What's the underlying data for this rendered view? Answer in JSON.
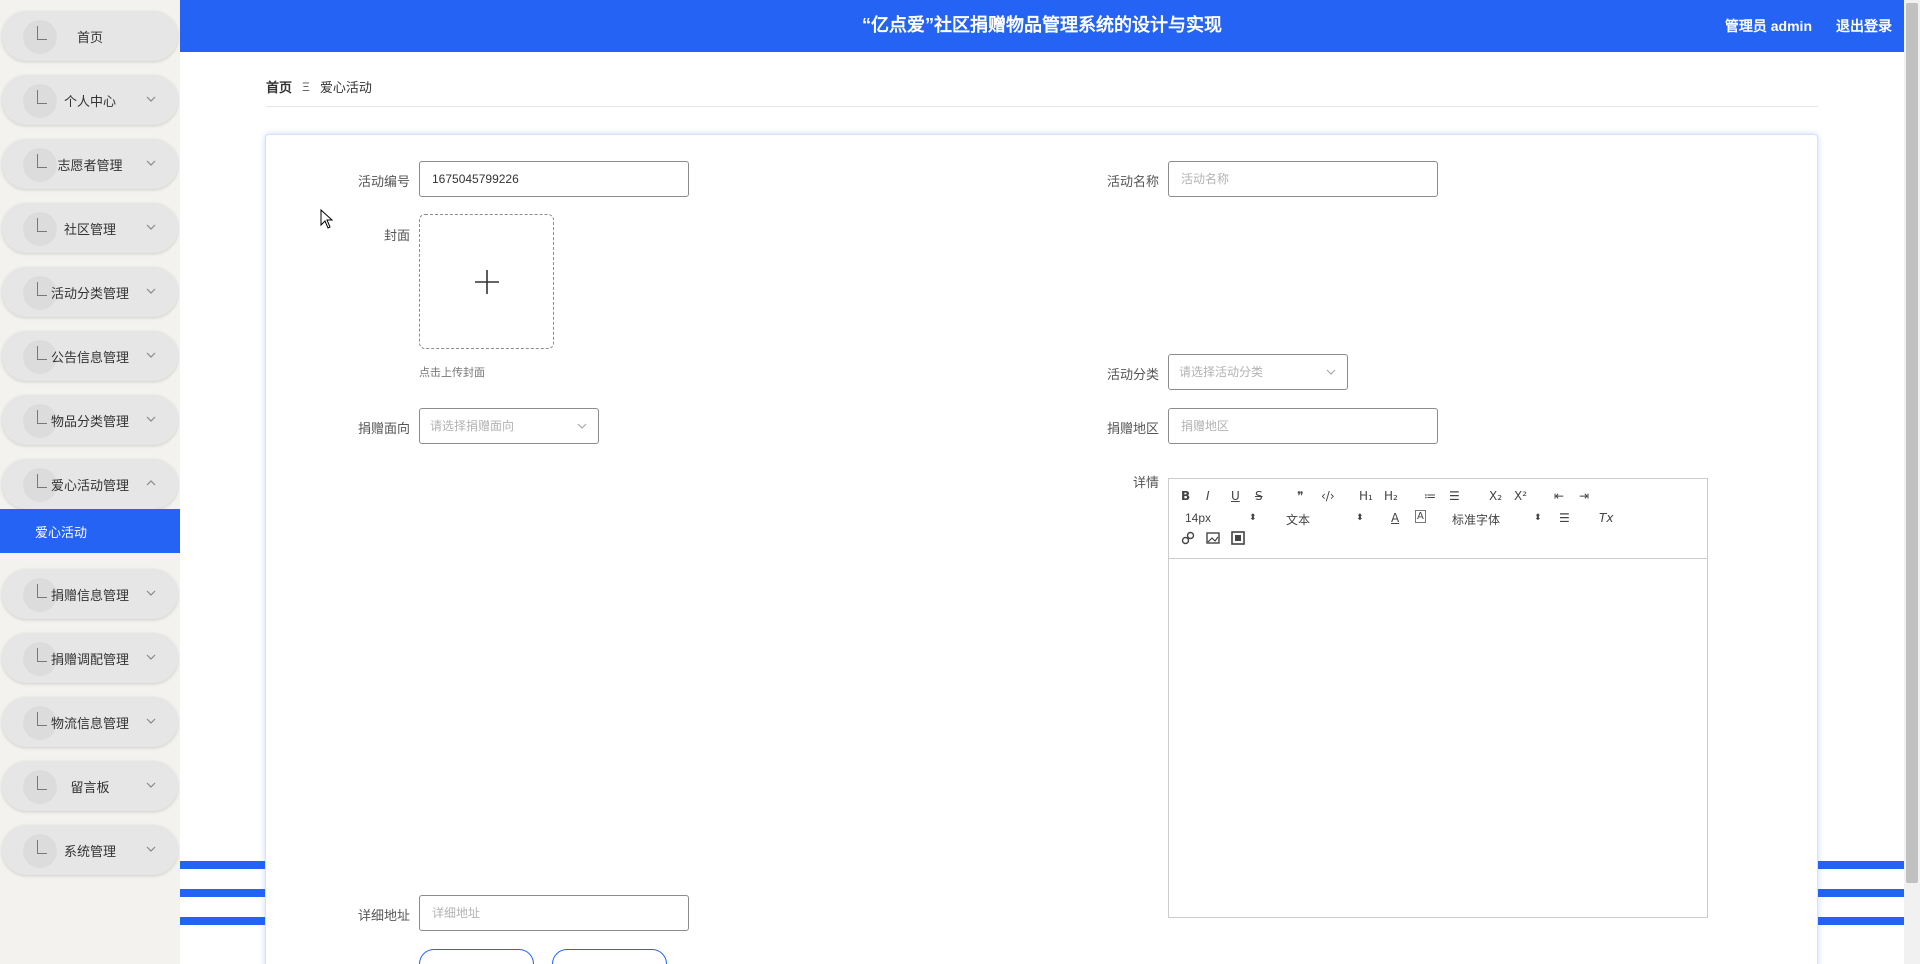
{
  "header": {
    "title": "“亿点爱”社区捐赠物品管理系统的设计与实现",
    "user_label": "管理员 admin",
    "logout_label": "退出登录"
  },
  "sidebar": {
    "items": [
      {
        "label": "首页",
        "has_chevron": false
      },
      {
        "label": "个人中心",
        "has_chevron": true
      },
      {
        "label": "志愿者管理",
        "has_chevron": true
      },
      {
        "label": "社区管理",
        "has_chevron": true
      },
      {
        "label": "活动分类管理",
        "has_chevron": true
      },
      {
        "label": "公告信息管理",
        "has_chevron": true
      },
      {
        "label": "物品分类管理",
        "has_chevron": true
      },
      {
        "label": "爱心活动管理",
        "has_chevron": true,
        "expanded": true
      },
      {
        "label": "捐赠信息管理",
        "has_chevron": true
      },
      {
        "label": "捐赠调配管理",
        "has_chevron": true
      },
      {
        "label": "物流信息管理",
        "has_chevron": true
      },
      {
        "label": "留言板",
        "has_chevron": true
      },
      {
        "label": "系统管理",
        "has_chevron": true
      }
    ],
    "active_sub_item": "爱心活动"
  },
  "breadcrumb": {
    "home": "首页",
    "separator": "Ξ",
    "current": "爱心活动"
  },
  "form": {
    "activity_no": {
      "label": "活动编号",
      "value": "1675045799226"
    },
    "activity_name": {
      "label": "活动名称",
      "placeholder": "活动名称"
    },
    "cover": {
      "label": "封面",
      "tip": "点击上传封面"
    },
    "activity_category": {
      "label": "活动分类",
      "placeholder": "请选择活动分类"
    },
    "donation_target": {
      "label": "捐赠面向",
      "placeholder": "请选择捐赠面向"
    },
    "donation_area": {
      "label": "捐赠地区",
      "placeholder": "捐赠地区"
    },
    "details": {
      "label": "详情"
    },
    "address": {
      "label": "详细地址",
      "placeholder": "详细地址"
    }
  },
  "editor": {
    "toolbar_row1": [
      "B",
      "I",
      "U",
      "S",
      "❞",
      "‹/›",
      "H₁",
      "H₂",
      "≔",
      "☰",
      "X₂",
      "X²",
      "⇤",
      "⇥"
    ],
    "font_size": "14px",
    "paragraph": "文本",
    "font_family": "标准字体",
    "clean_icon": "Tx"
  },
  "colors": {
    "primary": "#2463f4",
    "sidebar_bg": "#f3f2ee"
  }
}
